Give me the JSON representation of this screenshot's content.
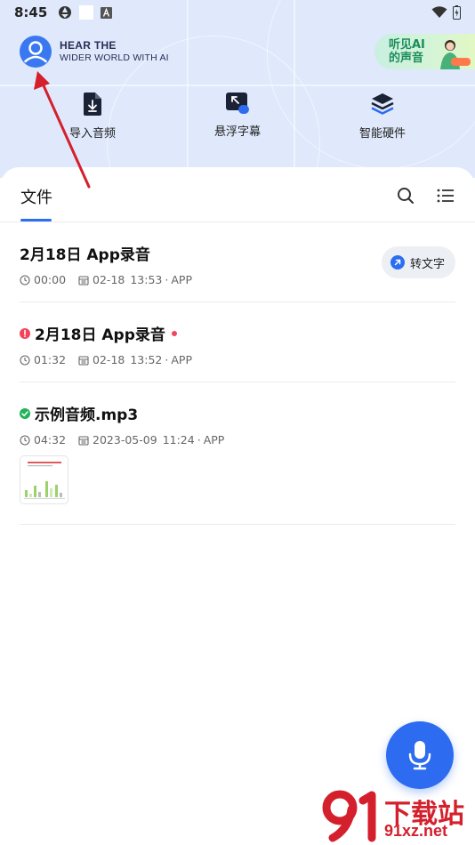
{
  "status_bar": {
    "time": "8:45"
  },
  "header": {
    "brand_line1": "HEAR THE",
    "brand_line2": "WIDER WORLD WITH AI",
    "banner_text_line1": "听见AI",
    "banner_text_line2": "的声音"
  },
  "tools": [
    {
      "label": "导入音频",
      "icon": "import-audio-icon"
    },
    {
      "label": "悬浮字幕",
      "icon": "floating-subtitle-icon"
    },
    {
      "label": "智能硬件",
      "icon": "smart-hardware-icon"
    }
  ],
  "tabs": {
    "files": "文件"
  },
  "files": [
    {
      "title": "2月18日 App录音",
      "duration": "00:00",
      "date": "02-18",
      "time": "13:53",
      "source": "APP",
      "action": "转文字",
      "status": "none"
    },
    {
      "title": "2月18日 App录音",
      "duration": "01:32",
      "date": "02-18",
      "time": "13:52",
      "source": "APP",
      "status": "error"
    },
    {
      "title": "示例音频.mp3",
      "duration": "04:32",
      "date": "2023-05-09",
      "time": "11:24",
      "source": "APP",
      "status": "done"
    }
  ],
  "watermark": {
    "text": "下载站",
    "url": "91xz.net"
  },
  "colors": {
    "accent": "#2d6cf0",
    "header_bg": "#dfe9fb",
    "error": "#f2445b",
    "success": "#1fb35a",
    "annotation_arrow": "#d4202c"
  }
}
